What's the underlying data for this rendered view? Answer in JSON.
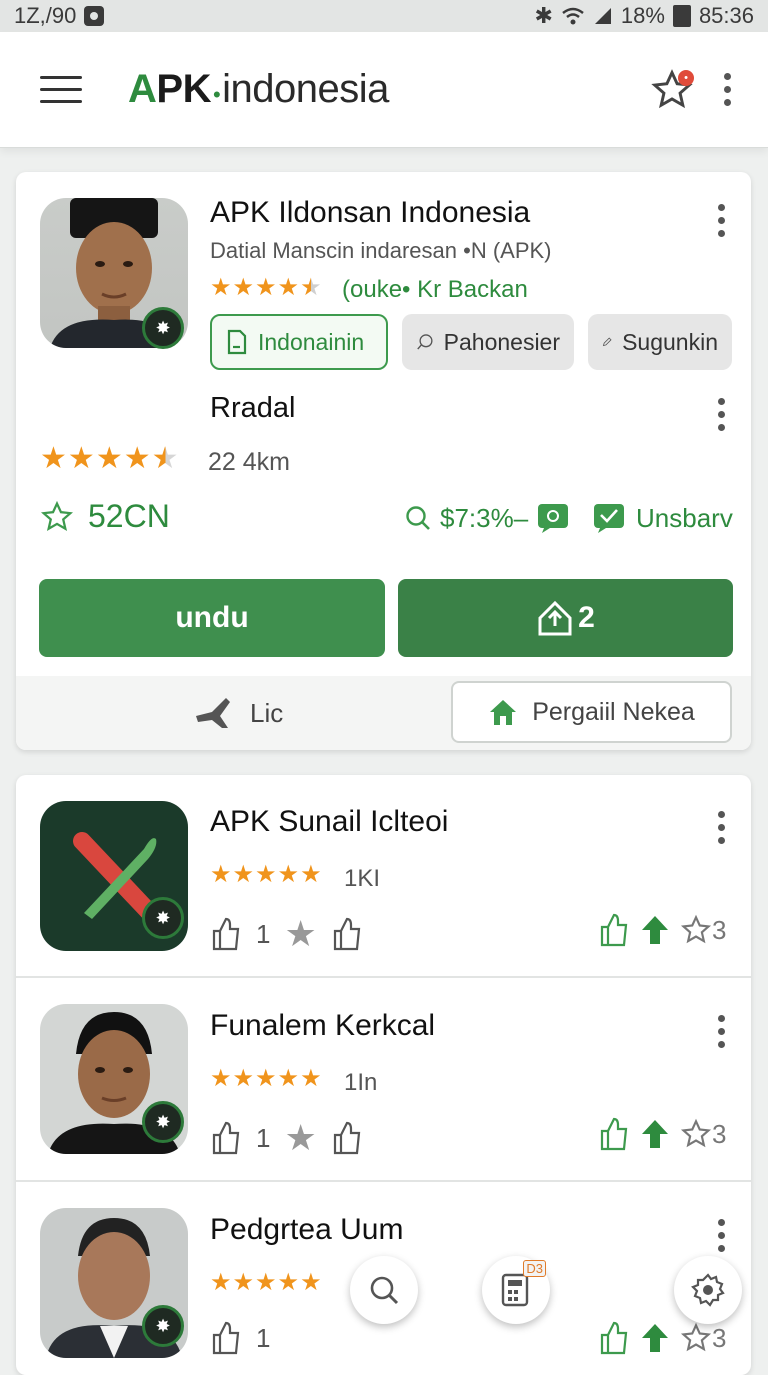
{
  "status": {
    "time": "1Z,/90",
    "battery": "18%",
    "clock": "85:36"
  },
  "appbar": {
    "logo_a": "A",
    "logo_pk": "PK",
    "logo_dot": "•",
    "logo_rest": "indonesia"
  },
  "featured": {
    "title": "APK Ildonsan Indonesia",
    "subtitle": "Datial Manscin indaresan •N (APK)",
    "rating_caption": "(ouke• Kr Backan",
    "chips": [
      "Indonainin",
      "Pahonesier",
      "Sugunkin"
    ],
    "section_title": "Rradal",
    "distance": "22 4km",
    "favorites": "52CN",
    "search_stat": "$7:3%–",
    "status_label": "Unsbarv",
    "download_label": "undu",
    "share_count": "2",
    "secondary_left": "Lic",
    "secondary_right": "Pergaiil Nekea",
    "rating": 4.5,
    "section_rating": 4.5
  },
  "list": [
    {
      "title": "APK Sunail Iclteoi",
      "count": "1KI",
      "likes": "1",
      "right_count": "3",
      "rating": 5
    },
    {
      "title": "Funalem Kerkcal",
      "count": "1In",
      "likes": "1",
      "right_count": "3",
      "rating": 5
    },
    {
      "title": "Pedgrtea Uum",
      "count": "",
      "likes": "1",
      "right_count": "3",
      "rating": 5
    }
  ],
  "fab": {
    "badge": "D3"
  },
  "colors": {
    "accent": "#2e8b3e",
    "star": "#f0941c",
    "button": "#3f8f4e"
  }
}
